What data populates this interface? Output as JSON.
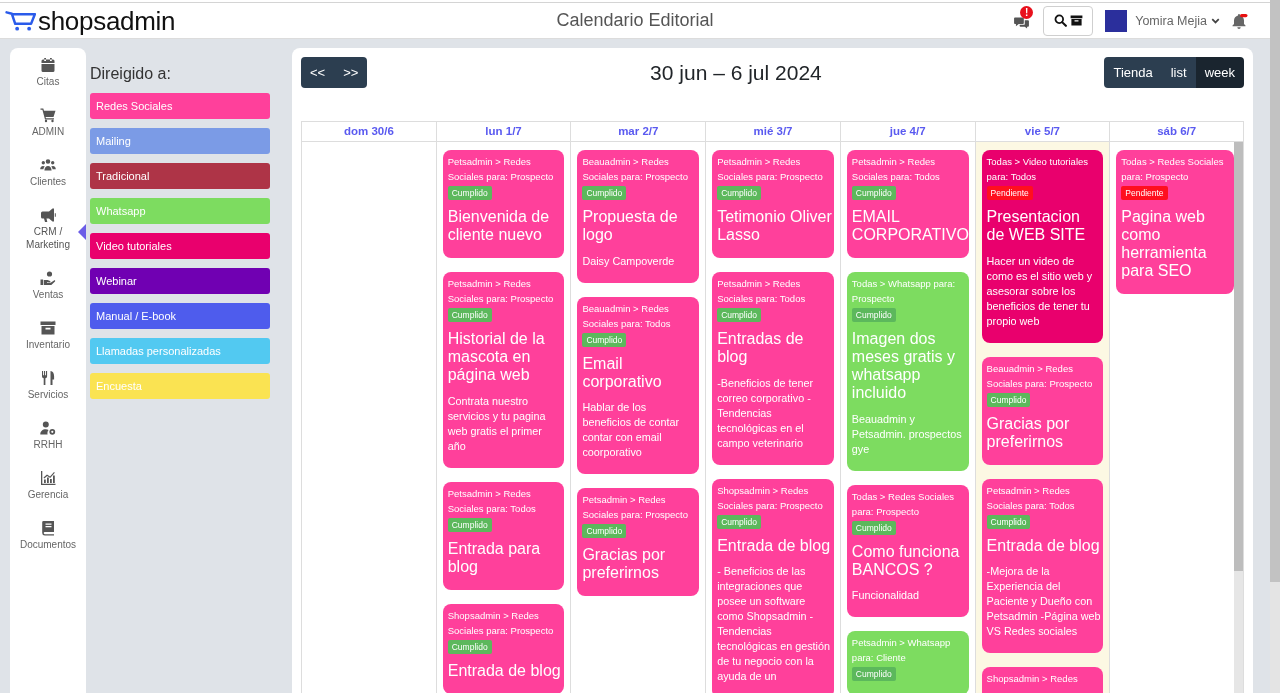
{
  "topbar": {
    "logo": "shopsadmin",
    "title": "Calendario Editorial",
    "messages_badge": "!",
    "user_name": "Yomira Mejia"
  },
  "nav": [
    {
      "label": "Citas",
      "selected": false
    },
    {
      "label": "ADMIN",
      "selected": false
    },
    {
      "label": "Clientes",
      "selected": false
    },
    {
      "label": "CRM / Marketing",
      "selected": true
    },
    {
      "label": "Ventas",
      "selected": false
    },
    {
      "label": "Inventario",
      "selected": false
    },
    {
      "label": "Servicios",
      "selected": false
    },
    {
      "label": "RRHH",
      "selected": false
    },
    {
      "label": "Gerencia",
      "selected": false
    },
    {
      "label": "Documentos",
      "selected": false
    }
  ],
  "legend": {
    "title": "Direigido a:",
    "items": [
      {
        "label": "Redes Sociales",
        "color": "#ff409b"
      },
      {
        "label": "Mailing",
        "color": "#7b9be6"
      },
      {
        "label": "Tradicional",
        "color": "#ae3447"
      },
      {
        "label": "Whatsapp",
        "color": "#7ddc60"
      },
      {
        "label": "Video tutoriales",
        "color": "#e9006d"
      },
      {
        "label": "Webinar",
        "color": "#7000b2"
      },
      {
        "label": "Manual / E-book",
        "color": "#4e5ced"
      },
      {
        "label": "Llamadas personalizadas",
        "color": "#52c9f1"
      },
      {
        "label": "Encuesta",
        "color": "#fae352"
      }
    ]
  },
  "calendar": {
    "nav_buttons": [
      "<<",
      ">>"
    ],
    "title": "30 jun – 6 jul 2024",
    "views": [
      {
        "label": "Tienda",
        "selected": false
      },
      {
        "label": "list",
        "selected": false
      },
      {
        "label": "week",
        "selected": true
      }
    ],
    "days": [
      {
        "label": "dom 30/6",
        "today": false
      },
      {
        "label": "lun 1/7",
        "today": false,
        "events": [
          {
            "meta": "Petsadmin > Redes Sociales para: Prospecto",
            "status": "Cumplido",
            "completed": true,
            "title": "Bienvenida de cliente nuevo",
            "color": "#ff409b"
          },
          {
            "meta": "Petsadmin > Redes Sociales para: Prospecto",
            "status": "Cumplido",
            "completed": true,
            "title": "Historial de la mascota en página web",
            "description": "Contrata nuestro servicios y tu pagina web gratis el primer año",
            "color": "#ff409b"
          },
          {
            "meta": "Petsadmin > Redes Sociales para: Todos",
            "status": "Cumplido",
            "completed": true,
            "title": "Entrada para blog",
            "color": "#ff409b"
          },
          {
            "meta": "Shopsadmin > Redes Sociales para: Prospecto",
            "status": "Cumplido",
            "completed": true,
            "title": "Entrada de blog",
            "color": "#ff409b"
          }
        ]
      },
      {
        "label": "mar 2/7",
        "today": false,
        "events": [
          {
            "meta": "Beauadmin > Redes Sociales para: Prospecto",
            "status": "Cumplido",
            "completed": true,
            "title": "Propuesta de logo",
            "description": "Daisy Campoverde",
            "color": "#ff409b"
          },
          {
            "meta": "Beauadmin > Redes Sociales para: Todos",
            "status": "Cumplido",
            "completed": true,
            "title": "Email corporativo",
            "description": "Hablar de los beneficios de contar contar con email coorporativo",
            "color": "#ff409b"
          },
          {
            "meta": "Petsadmin > Redes Sociales para: Prospecto",
            "status": "Cumplido",
            "completed": true,
            "title": "Gracias por preferirnos",
            "color": "#ff409b"
          }
        ]
      },
      {
        "label": "mié 3/7",
        "today": false,
        "events": [
          {
            "meta": "Petsadmin > Redes Sociales para: Prospecto",
            "status": "Cumplido",
            "completed": true,
            "title": "Tetimonio Oliver Lasso",
            "color": "#ff409b"
          },
          {
            "meta": "Petsadmin > Redes Sociales para: Todos",
            "status": "Cumplido",
            "completed": true,
            "title": "Entradas de blog",
            "description": "-Beneficios de tener correo corporativo - Tendencias tecnológicas en el campo veterinario",
            "color": "#ff409b"
          },
          {
            "meta": "Shopsadmin > Redes Sociales para: Prospecto",
            "status": "Cumplido",
            "completed": true,
            "title": "Entrada de blog",
            "description": "- Beneficios de las integraciones que posee un software como Shopsadmin - Tendencias tecnológicas en gestión de tu negocio con la ayuda de un",
            "color": "#ff409b"
          }
        ]
      },
      {
        "label": "jue 4/7",
        "today": false,
        "events": [
          {
            "meta": "Petsadmin > Redes Sociales para: Todos",
            "status": "Cumplido",
            "completed": true,
            "title": "EMAIL CORPORATIVO",
            "color": "#ff409b"
          },
          {
            "meta": "Todas > Whatsapp para: Prospecto",
            "status": "Cumplido",
            "completed": true,
            "title": "Imagen dos meses gratis y whatsapp incluido",
            "description": "Beauadmin y Petsadmin. prospectos gye",
            "color": "#7ddc60"
          },
          {
            "meta": "Todas > Redes Sociales para: Prospecto",
            "status": "Cumplido",
            "completed": true,
            "title": "Como funciona BANCOS ?",
            "description": "Funcionalidad",
            "color": "#ff409b"
          },
          {
            "meta": "Petsadmin > Whatsapp para: Cliente",
            "status": "Cumplido",
            "completed": true,
            "color": "#7ddc60"
          }
        ]
      },
      {
        "label": "vie 5/7",
        "today": true,
        "events": [
          {
            "meta": "Todas > Video tutoriales para: Todos",
            "status": "Pendiente",
            "completed": false,
            "title": "Presentacion de WEB SITE",
            "description": "Hacer un video de como es el sitio web y asesorar sobre los beneficios de tener tu propio web",
            "color": "#e9006d"
          },
          {
            "meta": "Beauadmin > Redes Sociales para: Prospecto",
            "status": "Cumplido",
            "completed": true,
            "title": "Gracias por preferirnos",
            "color": "#ff409b"
          },
          {
            "meta": "Petsadmin > Redes Sociales para: Todos",
            "status": "Cumplido",
            "completed": true,
            "title": "Entrada de blog",
            "description": "-Mejora de la Experiencia del Paciente y Dueño con Petsadmin -Página web VS Redes sociales",
            "color": "#ff409b"
          },
          {
            "meta": "Shopsadmin > Redes",
            "color": "#ff409b"
          }
        ]
      },
      {
        "label": "sáb 6/7",
        "today": false,
        "events": [
          {
            "meta": "Todas > Redes Sociales para: Prospecto",
            "status": "Pendiente",
            "completed": false,
            "title": "Pagina web como herramienta para SEO",
            "color": "#ff409b"
          }
        ]
      }
    ]
  }
}
